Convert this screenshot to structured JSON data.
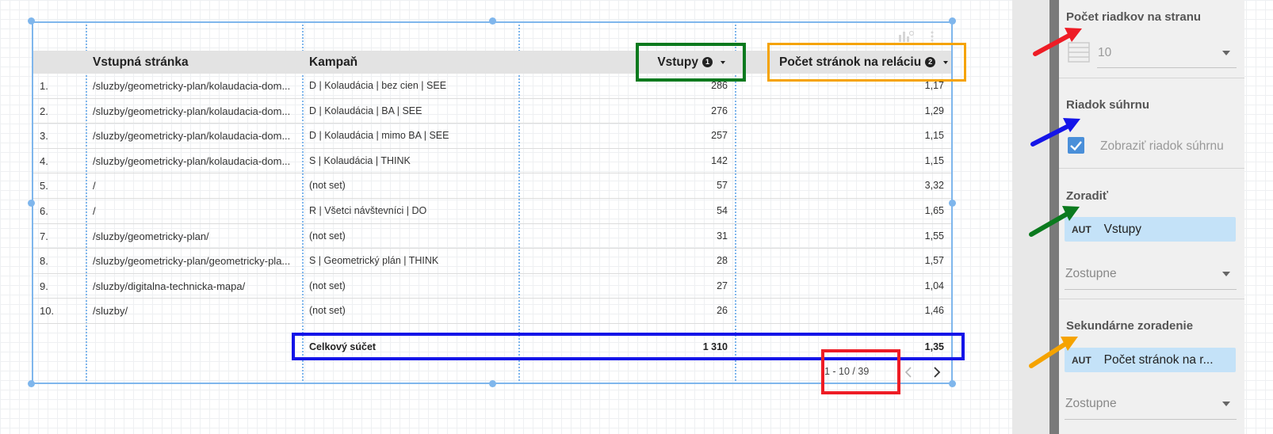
{
  "table": {
    "headers": {
      "landing_page": "Vstupná stránka",
      "campaign": "Kampaň",
      "entries": "Vstupy",
      "pages_per_session": "Počet stránok na reláciu"
    },
    "header_info_icons": {
      "entries": "❶",
      "pages_per_session": "❷"
    },
    "rows": [
      {
        "idx": "1.",
        "page": "/sluzby/geometricky-plan/kolaudacia-dom...",
        "campaign": "D | Kolaudácia | bez cien | SEE",
        "entries": "286",
        "pps": "1,17"
      },
      {
        "idx": "2.",
        "page": "/sluzby/geometricky-plan/kolaudacia-dom...",
        "campaign": "D | Kolaudácia | BA | SEE",
        "entries": "276",
        "pps": "1,29"
      },
      {
        "idx": "3.",
        "page": "/sluzby/geometricky-plan/kolaudacia-dom...",
        "campaign": "D | Kolaudácia | mimo BA | SEE",
        "entries": "257",
        "pps": "1,15"
      },
      {
        "idx": "4.",
        "page": "/sluzby/geometricky-plan/kolaudacia-dom...",
        "campaign": "S | Kolaudácia | THINK",
        "entries": "142",
        "pps": "1,15"
      },
      {
        "idx": "5.",
        "page": "/",
        "campaign": "(not set)",
        "entries": "57",
        "pps": "3,32"
      },
      {
        "idx": "6.",
        "page": "/",
        "campaign": "R | Všetci návštevníci | DO",
        "entries": "54",
        "pps": "1,65"
      },
      {
        "idx": "7.",
        "page": "/sluzby/geometricky-plan/",
        "campaign": "(not set)",
        "entries": "31",
        "pps": "1,55"
      },
      {
        "idx": "8.",
        "page": "/sluzby/geometricky-plan/geometricky-pla...",
        "campaign": "S | Geometrický plán | THINK",
        "entries": "28",
        "pps": "1,57"
      },
      {
        "idx": "9.",
        "page": "/sluzby/digitalna-technicka-mapa/",
        "campaign": "(not set)",
        "entries": "27",
        "pps": "1,04"
      },
      {
        "idx": "10.",
        "page": "/sluzby/",
        "campaign": "(not set)",
        "entries": "26",
        "pps": "1,46"
      }
    ],
    "total": {
      "label": "Celkový súčet",
      "entries": "1 310",
      "pps": "1,35"
    },
    "pagination": {
      "range": "1 - 10 / 39",
      "prev": "‹",
      "next": "›"
    }
  },
  "sidebar": {
    "rows_per_page": {
      "title": "Počet riadkov na stranu",
      "value": "10"
    },
    "summary_row": {
      "title": "Riadok súhrnu",
      "checkbox_label": "Zobraziť riadok súhrnu",
      "checked": true
    },
    "sort": {
      "title": "Zoradiť",
      "tag": "AUT",
      "field": "Vstupy",
      "order": "Zostupne"
    },
    "secondary_sort": {
      "title": "Sekundárne zoradenie",
      "tag": "AUT",
      "field": "Počet stránok na r...",
      "order": "Zostupne"
    }
  },
  "annotation_colors": {
    "red": "#ee1c25",
    "blue": "#1515e8",
    "green": "#0b7a1e",
    "orange": "#f5a300"
  }
}
